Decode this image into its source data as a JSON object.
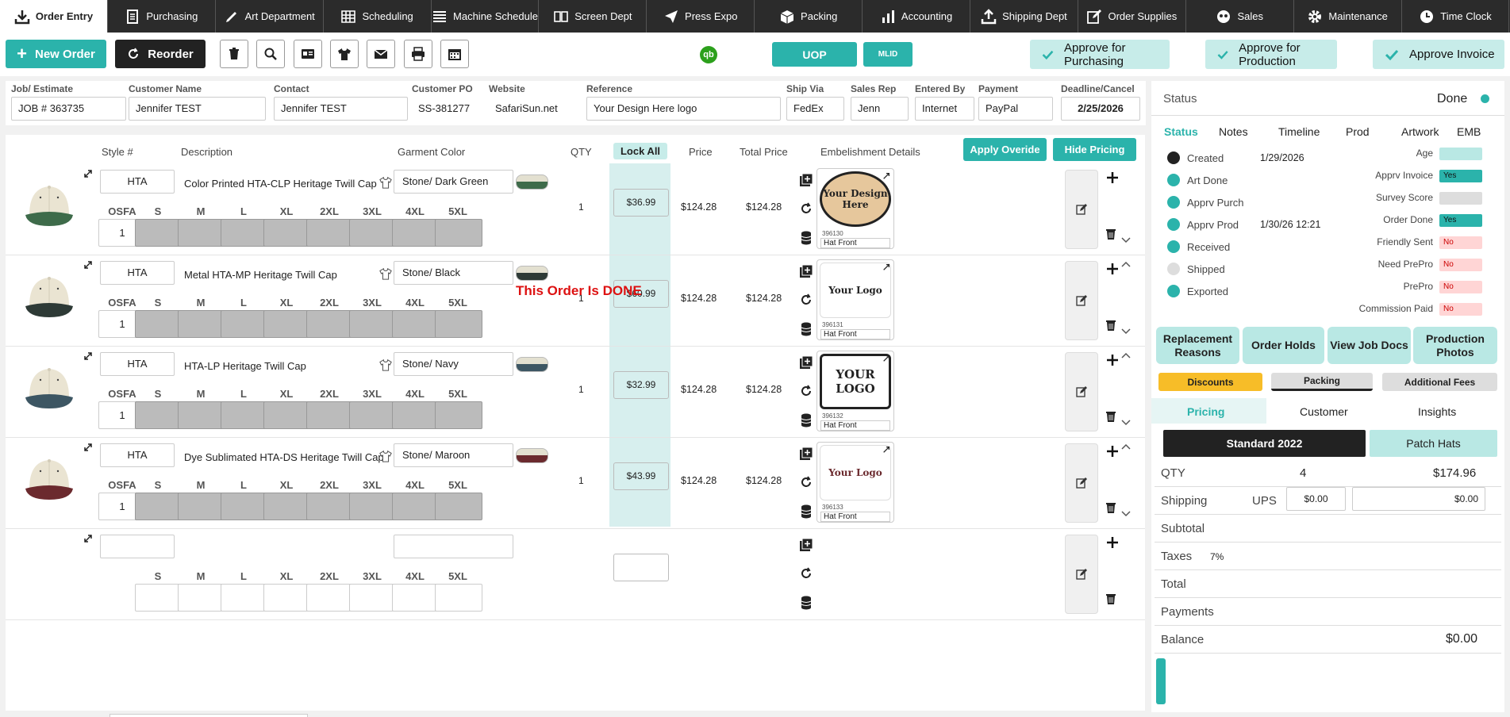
{
  "nav": [
    {
      "label": "Order Entry",
      "icon": "download-icon",
      "active": true
    },
    {
      "label": "Purchasing",
      "icon": "document-icon"
    },
    {
      "label": "Art Department",
      "icon": "pen-icon"
    },
    {
      "label": "Scheduling",
      "icon": "grid-icon"
    },
    {
      "label": "Machine Schedule",
      "icon": "list-icon"
    },
    {
      "label": "Screen Dept",
      "icon": "screens-icon"
    },
    {
      "label": "Press Expo",
      "icon": "send-icon"
    },
    {
      "label": "Packing",
      "icon": "box-icon"
    },
    {
      "label": "Accounting",
      "icon": "bar-chart-icon"
    },
    {
      "label": "Shipping Dept",
      "icon": "upload-icon"
    },
    {
      "label": "Order Supplies",
      "icon": "edit-icon"
    },
    {
      "label": "Sales",
      "icon": "people-icon"
    },
    {
      "label": "Maintenance",
      "icon": "gear-icon"
    },
    {
      "label": "Time Clock",
      "icon": "clock-icon"
    }
  ],
  "toolbar": {
    "new_order": "New Order",
    "reorder": "Reorder",
    "qb": "qb",
    "uop": "UOP",
    "mlid": "MLID",
    "approve_purchasing": "Approve for Purchasing",
    "approve_production": "Approve for Production",
    "approve_invoice": "Approve Invoice"
  },
  "header": {
    "job_label": "Job/ Estimate",
    "job": "JOB # 363735",
    "customer_label": "Customer Name",
    "customer": "Jennifer TEST",
    "contact_label": "Contact",
    "contact": "Jennifer TEST",
    "po_label": "Customer PO",
    "po": "SS-381277",
    "website_label": "Website",
    "website": "SafariSun.net",
    "reference_label": "Reference",
    "reference": "Your Design Here logo",
    "shipvia_label": "Ship Via",
    "shipvia": "FedEx",
    "salesrep_label": "Sales Rep",
    "salesrep": "Jenn",
    "enteredby_label": "Entered By",
    "enteredby": "Internet",
    "payment_label": "Payment",
    "payment": "PayPal",
    "deadline_label": "Deadline/Cancel",
    "deadline": "2/25/2026"
  },
  "columns": {
    "style": "Style #",
    "description": "Description",
    "garment_color": "Garment Color",
    "qty": "QTY",
    "lock_all": "Lock All",
    "price": "Price",
    "total_price": "Total Price",
    "embellishment": "Embelishment Details",
    "apply_override": "Apply Overide",
    "hide_pricing": "Hide Pricing"
  },
  "sizes": [
    "OSFA",
    "S",
    "M",
    "L",
    "XL",
    "2XL",
    "3XL",
    "4XL",
    "5XL"
  ],
  "line_items": [
    {
      "style": "HTA",
      "description": "Color Printed HTA-CLP Heritage Twill Cap",
      "color": "Stone/ Dark Green",
      "bill": "#3e6b4a",
      "osfa": "1",
      "qty": "1",
      "price": "$36.99",
      "total1": "$124.28",
      "total2": "$124.28",
      "art_id": "396130",
      "art_loc": "Hat Front",
      "art": "Your Design Here"
    },
    {
      "style": "HTA",
      "description": "Metal HTA-MP Heritage Twill Cap",
      "color": "Stone/ Black",
      "bill": "#2e3a36",
      "osfa": "1",
      "qty": "1",
      "price": "$60.99",
      "total1": "$124.28",
      "total2": "$124.28",
      "art_id": "396131",
      "art_loc": "Hat Front",
      "art": "Your Logo"
    },
    {
      "style": "HTA",
      "description": "HTA-LP Heritage Twill Cap",
      "color": "Stone/ Navy",
      "bill": "#3d5663",
      "osfa": "1",
      "qty": "1",
      "price": "$32.99",
      "total1": "$124.28",
      "total2": "$124.28",
      "art_id": "396132",
      "art_loc": "Hat Front",
      "art": "YOUR LOGO"
    },
    {
      "style": "HTA",
      "description": "Dye Sublimated HTA-DS Heritage Twill Cap",
      "color": "Stone/ Maroon",
      "bill": "#6b2a2e",
      "osfa": "1",
      "qty": "1",
      "price": "$43.99",
      "total1": "$124.28",
      "total2": "$124.28",
      "art_id": "396133",
      "art_loc": "Hat Front",
      "art": "Your Logo"
    }
  ],
  "done_message": "This Order Is DONE",
  "status": {
    "label": "Status",
    "value": "Done",
    "tabs": [
      "Status",
      "Notes",
      "Timeline",
      "Prod",
      "Artwork",
      "EMB"
    ],
    "steps": [
      {
        "name": "Created",
        "date": "1/29/2026",
        "color": "#222"
      },
      {
        "name": "Art Done",
        "date": "",
        "color": "#2bb3ab"
      },
      {
        "name": "Apprv Purch",
        "date": "",
        "color": "#2bb3ab"
      },
      {
        "name": "Apprv Prod",
        "date": "1/30/26 12:21",
        "color": "#2bb3ab"
      },
      {
        "name": "Received",
        "date": "",
        "color": "#2bb3ab"
      },
      {
        "name": "Shipped",
        "date": "",
        "color": "#ddd"
      },
      {
        "name": "Exported",
        "date": "",
        "color": "#2bb3ab"
      }
    ],
    "flags": [
      {
        "name": "Age",
        "value": "",
        "color": "#b9e8e4"
      },
      {
        "name": "Apprv Invoice",
        "value": "Yes",
        "color": "#2bb3ab"
      },
      {
        "name": "Survey Score",
        "value": "",
        "color": "#ddd"
      },
      {
        "name": "Order Done",
        "value": "Yes",
        "color": "#2bb3ab"
      },
      {
        "name": "Friendly Sent",
        "value": "No",
        "color": "#ffd5d5"
      },
      {
        "name": "Need PrePro",
        "value": "No",
        "color": "#ffd5d5"
      },
      {
        "name": "PrePro",
        "value": "No",
        "color": "#ffd5d5"
      },
      {
        "name": "Commission Paid",
        "value": "No",
        "color": "#ffd5d5"
      }
    ]
  },
  "actions": {
    "replacement": "Replacement Reasons",
    "holds": "Order Holds",
    "docs": "View Job Docs",
    "photos": "Production Photos",
    "discounts": "Discounts",
    "packing": "Packing",
    "fees": "Additional Fees"
  },
  "pricing": {
    "tabs": [
      "Pricing",
      "Customer",
      "Insights"
    ],
    "standard": "Standard 2022",
    "patch": "Patch Hats",
    "qty_label": "QTY",
    "qty": "4",
    "qty_total": "$174.96",
    "shipping_label": "Shipping",
    "ups": "UPS",
    "ship1": "$0.00",
    "ship2": "$0.00",
    "subtotal_label": "Subtotal",
    "taxes_label": "Taxes",
    "tax_rate": "7%",
    "total_label": "Total",
    "payments_label": "Payments",
    "balance_label": "Balance",
    "balance": "$0.00"
  }
}
